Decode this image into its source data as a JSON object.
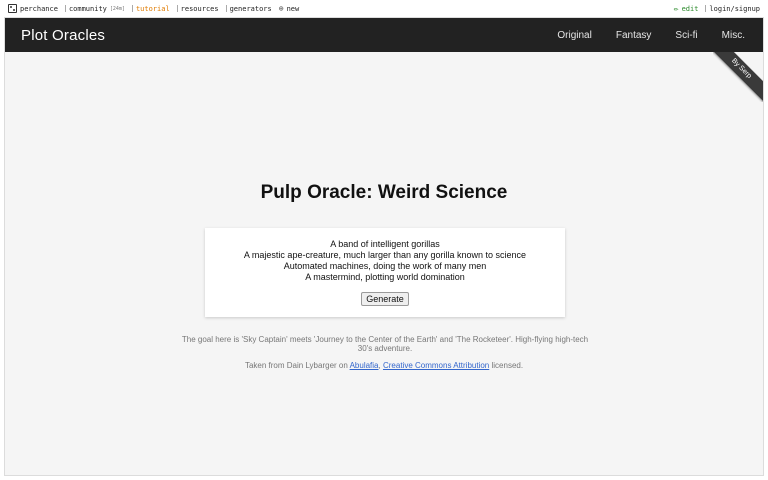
{
  "topbar": {
    "perchance": "perchance",
    "community": "community",
    "community_count": "[24m]",
    "tutorial": "tutorial",
    "resources": "resources",
    "generators": "generators",
    "new": "new",
    "edit": "edit",
    "login": "login/signup"
  },
  "nav": {
    "brand": "Plot Oracles",
    "links": [
      "Original",
      "Fantasy",
      "Sci-fi",
      "Misc."
    ]
  },
  "ribbon": "By Serp",
  "main": {
    "title": "Pulp Oracle: Weird Science",
    "results": [
      "A band of intelligent gorillas",
      "A majestic ape-creature, much larger than any gorilla known to science",
      "Automated machines, doing the work of many men",
      "A mastermind, plotting world domination"
    ],
    "generate_label": "Generate",
    "description": "The goal here is 'Sky Captain' meets 'Journey to the Center of the Earth' and 'The Rocketeer'. High-flying high-tech 30's adventure.",
    "credit_prefix": "Taken from Dain Lybarger on",
    "credit_link1": "Abulafia",
    "credit_sep": ",",
    "credit_link2": "Creative Commons Attribution",
    "credit_suffix": "licensed."
  },
  "icons": {
    "perchance": "die-icon",
    "community": "chat-icon",
    "tutorial": "book-icon",
    "resources": "folder-icon",
    "generators": "list-icon",
    "new": "plus-circle-icon",
    "edit": "pencil-icon",
    "login": "user-icon"
  },
  "colors": {
    "nav_bg": "#222222",
    "tutorial": "#e07b00",
    "edit": "#2a8a2a",
    "link": "#3366cc"
  }
}
